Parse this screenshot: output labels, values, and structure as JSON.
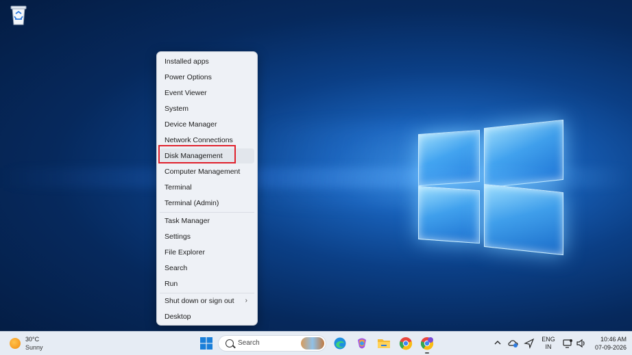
{
  "desktop": {
    "recycle_bin_icon": "recycle-bin-icon"
  },
  "context_menu": {
    "items": [
      {
        "label": "Installed apps"
      },
      {
        "label": "Power Options"
      },
      {
        "label": "Event Viewer"
      },
      {
        "label": "System"
      },
      {
        "label": "Device Manager"
      },
      {
        "label": "Network Connections"
      },
      {
        "label": "Disk Management",
        "highlighted": true
      },
      {
        "label": "Computer Management"
      },
      {
        "label": "Terminal"
      },
      {
        "label": "Terminal (Admin)"
      },
      {
        "label": "Task Manager"
      },
      {
        "label": "Settings"
      },
      {
        "label": "File Explorer"
      },
      {
        "label": "Search"
      },
      {
        "label": "Run"
      },
      {
        "label": "Shut down or sign out",
        "submenu": true
      },
      {
        "label": "Desktop"
      }
    ],
    "submenu_glyph": "›",
    "highlight_color": "#e0202c"
  },
  "taskbar": {
    "weather": {
      "temp": "30°C",
      "condition": "Sunny",
      "icon": "sun-icon"
    },
    "search": {
      "placeholder": "Search"
    },
    "apps": [
      "start-icon",
      "edge-icon",
      "copilot-icon",
      "file-explorer-icon",
      "chrome-icon",
      "chrome-profile-icon"
    ],
    "tray": {
      "language_line1": "ENG",
      "language_line2": "IN",
      "time": "10:46 AM",
      "date": "07-09-2026"
    }
  }
}
